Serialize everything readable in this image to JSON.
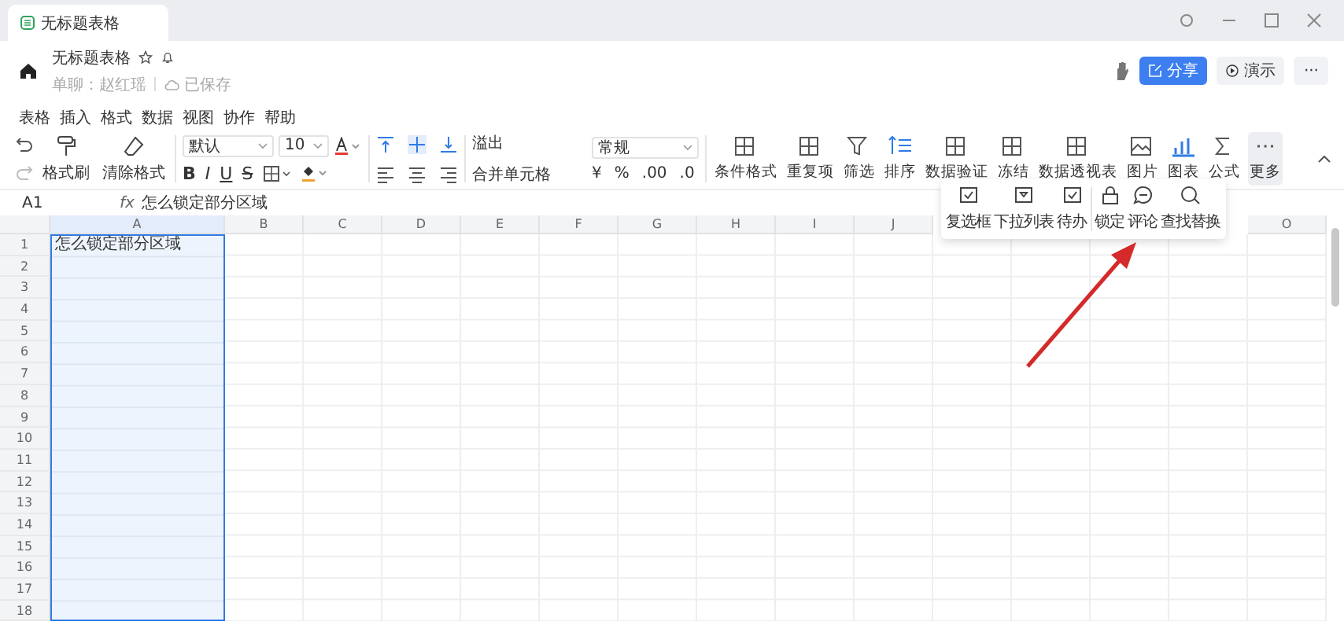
{
  "tab": {
    "title": "无标题表格",
    "selected": true
  },
  "doc": {
    "title": "无标题表格",
    "owner": "单聊：赵红瑶",
    "save_status": "已保存"
  },
  "header_buttons": [
    {
      "label": "分享",
      "kind": "primary"
    },
    {
      "label": "演示",
      "kind": "plain"
    },
    {
      "label": "···",
      "kind": "more"
    }
  ],
  "menu": [
    "表格",
    "插入",
    "格式",
    "数据",
    "视图",
    "协作",
    "帮助"
  ],
  "toolbar": {
    "brush": "格式刷",
    "clear": "清除格式",
    "font": "默认",
    "size": "10",
    "text_marks": [
      "B",
      "I",
      "U",
      "S"
    ],
    "wrap": "溢出",
    "merge": "合并单元格",
    "number_format": "常规",
    "number_marks": [
      "¥",
      "%",
      ".00",
      ".0"
    ],
    "tools": [
      {
        "label": "条件格式",
        "selected": false
      },
      {
        "label": "重复项",
        "selected": false
      },
      {
        "label": "筛选",
        "selected": false
      },
      {
        "label": "排序",
        "selected": false
      },
      {
        "label": "数据验证",
        "selected": false
      },
      {
        "label": "冻结",
        "selected": false
      },
      {
        "label": "数据透视表",
        "selected": false
      },
      {
        "label": "图片",
        "selected": false
      },
      {
        "label": "图表",
        "selected": false
      },
      {
        "label": "公式",
        "selected": false
      },
      {
        "label": "更多",
        "selected": true
      }
    ]
  },
  "more_popup": [
    "复选框",
    "下拉列表",
    "待办",
    "锁定",
    "评论",
    "查找替换"
  ],
  "formula_bar": {
    "cell": "A1",
    "fx": "fx",
    "value": "怎么锁定部分区域"
  },
  "sheet": {
    "columns": [
      {
        "label": "A",
        "selected": true
      },
      {
        "label": "B",
        "selected": false
      },
      {
        "label": "C",
        "selected": false
      },
      {
        "label": "D",
        "selected": false
      },
      {
        "label": "E",
        "selected": false
      },
      {
        "label": "F",
        "selected": false
      },
      {
        "label": "G",
        "selected": false
      },
      {
        "label": "H",
        "selected": false
      },
      {
        "label": "I",
        "selected": false
      },
      {
        "label": "J",
        "selected": false
      },
      {
        "label": "O",
        "selected": false
      }
    ],
    "rows": [
      "1",
      "2",
      "3",
      "4",
      "5",
      "6",
      "7",
      "8",
      "9",
      "10",
      "11",
      "12",
      "13",
      "14",
      "15",
      "16",
      "17",
      "18"
    ],
    "a1": "怎么锁定部分区域"
  }
}
